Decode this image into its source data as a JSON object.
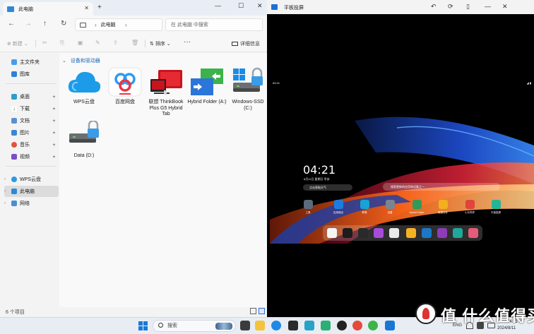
{
  "explorer": {
    "tab_title": "此电脑",
    "tab_close": "✕",
    "new_tab": "+",
    "controls": {
      "minimize": "—",
      "maximize": "☐",
      "close": "✕"
    },
    "nav": {
      "back": "←",
      "forward": "→",
      "up": "↑",
      "refresh": "↻"
    },
    "address": {
      "segment": "此电脑",
      "separator": "›",
      "trail": "›"
    },
    "search_placeholder": "在 此电脑 中搜索",
    "toolbar": {
      "new_label": "新建",
      "new_chevron": "⌄",
      "sort_label": "排序",
      "more": "···",
      "details_label": "详细信息"
    },
    "sidebar": {
      "items": [
        {
          "label": "主文件夹",
          "icon": "home-icon"
        },
        {
          "label": "图库",
          "icon": "gallery-icon"
        },
        {
          "label": "桌面",
          "icon": "desktop-icon",
          "pinned": true
        },
        {
          "label": "下载",
          "icon": "download-icon",
          "pinned": true
        },
        {
          "label": "文档",
          "icon": "document-icon",
          "pinned": true
        },
        {
          "label": "图片",
          "icon": "pictures-icon",
          "pinned": true
        },
        {
          "label": "音乐",
          "icon": "music-icon",
          "pinned": true
        },
        {
          "label": "视频",
          "icon": "videos-icon",
          "pinned": true
        },
        {
          "label": "WPS云盘",
          "icon": "wps-cloud-icon"
        },
        {
          "label": "此电脑",
          "icon": "this-pc-icon",
          "selected": true
        },
        {
          "label": "网络",
          "icon": "network-icon"
        }
      ],
      "pin_glyph": "📌",
      "chevron": "›"
    },
    "group_header": "设备和驱动器",
    "group_chevron": "⌄",
    "items": [
      {
        "name": "WPS云盘",
        "icon": "wps-cloud-icon"
      },
      {
        "name": "百度网盘",
        "icon": "baidu-netdisk-icon"
      },
      {
        "name": "联想 ThinkBook Plus G5 Hybrid Tab",
        "icon": "tablet-device-icon"
      },
      {
        "name": "Hybrid Folder (A:)",
        "icon": "hybrid-folder-icon"
      },
      {
        "name": "Windows-SSD (C:)",
        "icon": "windows-drive-icon"
      },
      {
        "name": "Data (D:)",
        "icon": "locked-drive-icon"
      }
    ],
    "status": "6 个项目"
  },
  "tablet": {
    "title": "平板投屏",
    "controls": {
      "back": "↶",
      "rotate": "⟳",
      "phone": "▯",
      "minimize": "—",
      "close": "✕"
    },
    "status_time": "04:21",
    "status_right": "◢ ▮",
    "clock": "04:21",
    "date": "8月11日 星期日 早安",
    "weather_chip": "点击获取天气",
    "search_text": "搜索更新的应用和设备之一",
    "apps": [
      {
        "label": "工具",
        "color": "#5a6b7d"
      },
      {
        "label": "应用商店",
        "color": "#1e7ce0"
      },
      {
        "label": "联想",
        "color": "#17a2d8"
      },
      {
        "label": "设置",
        "color": "#7b8590"
      },
      {
        "label": "Hybrid Folder",
        "color": "#2f9a5a"
      },
      {
        "label": "联想文件",
        "color": "#f2b01e"
      },
      {
        "label": "小乐同学",
        "color": "#e0443a"
      },
      {
        "label": "平板投屏",
        "color": "#22b59a"
      }
    ],
    "dock": [
      {
        "name": "calendar",
        "color": "#f4f4f4"
      },
      {
        "name": "clock",
        "color": "#1c1c1c"
      },
      {
        "name": "audio",
        "color": "#2a2a2a"
      },
      {
        "name": "gallery",
        "color": "#a64cd9"
      },
      {
        "name": "camera",
        "color": "#eaeaea"
      },
      {
        "name": "notes",
        "color": "#f5b321"
      },
      {
        "name": "hybrid",
        "color": "#1b78c9"
      },
      {
        "name": "mirror",
        "color": "#8e3bb8"
      },
      {
        "name": "market",
        "color": "#1fa89a"
      },
      {
        "name": "more",
        "color": "#e65a7a"
      }
    ]
  },
  "taskbar": {
    "search_label": "搜索",
    "lang": "ENG",
    "time": "04:21",
    "date": "2024/8/11"
  },
  "watermark": "值 什么值得买"
}
